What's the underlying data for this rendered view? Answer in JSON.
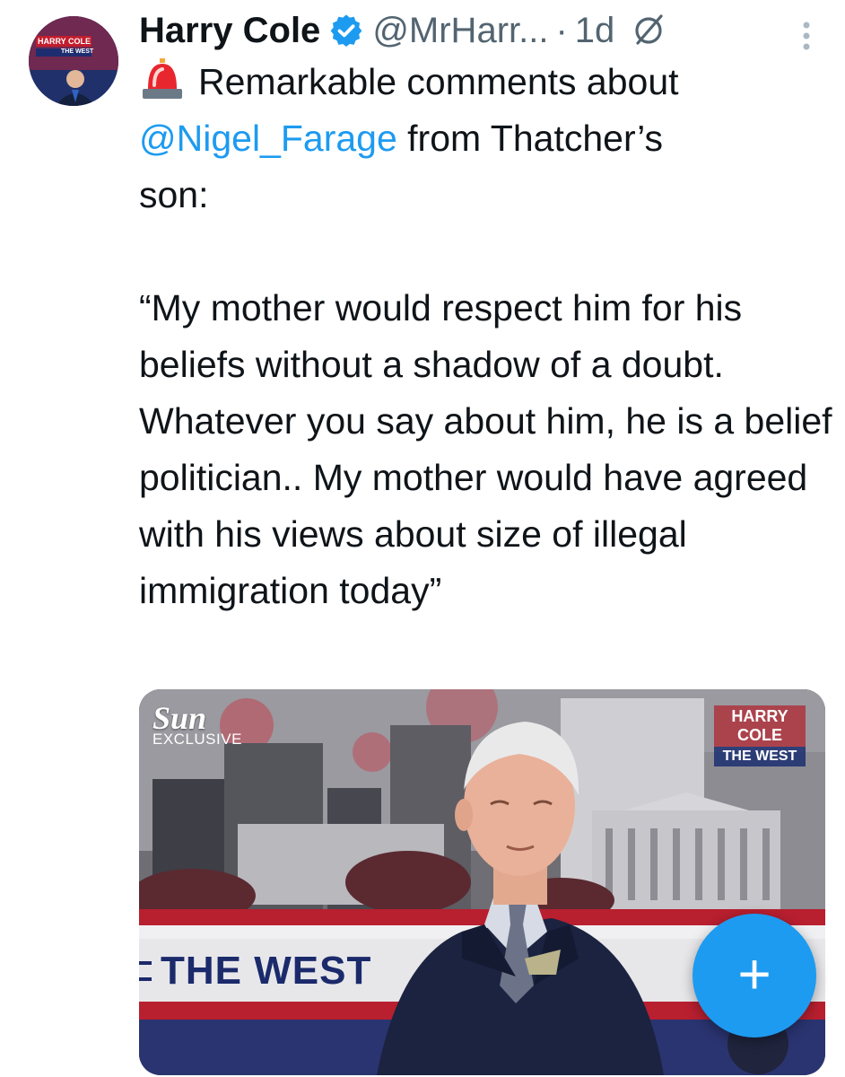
{
  "tweet": {
    "author_name": "Harry Cole",
    "handle": "@MrHarr...",
    "separator": "·",
    "time": "1d",
    "text_mention": "@Nigel_Farage",
    "text_line1": "Remarkable comments about",
    "text_after_mention": " from Thatcher’s\nson:\n\n“My mother would respect him for his beliefs without a shadow of a doubt. Whatever you say about him, he is a belief politician.. My mother would have agreed with his views about size of illegal immigration today”"
  },
  "avatar": {
    "overlay_line1": "HARRY COLE",
    "overlay_line2": "THE WEST"
  },
  "media": {
    "logo_brand": "Sun",
    "logo_tag": "EXCLUSIVE",
    "badge_line1": "HARRY COLE",
    "badge_line2": "THE WEST",
    "banner_text": "THE WEST"
  },
  "fab": {
    "label": "+"
  },
  "colors": {
    "accent": "#1d9bf0",
    "text": "#0f1419",
    "muted": "#536471"
  }
}
